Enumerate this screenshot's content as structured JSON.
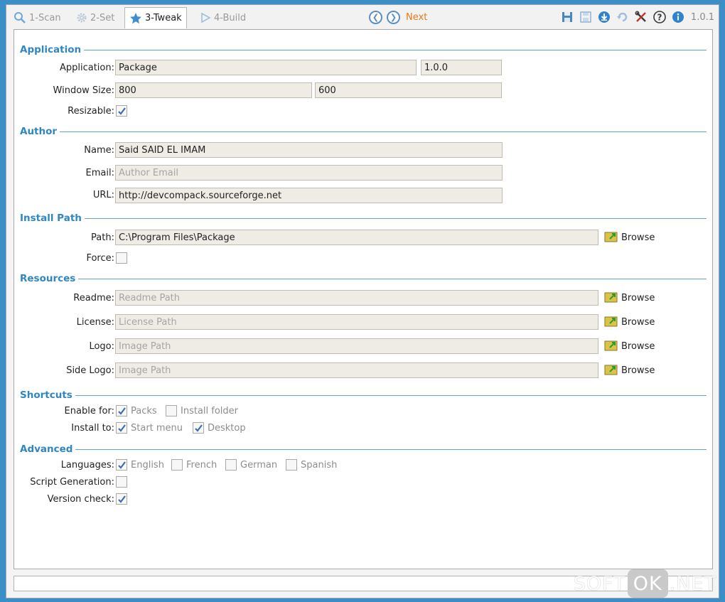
{
  "toolbar": {
    "tabs": [
      {
        "label": "1-Scan",
        "icon": "search-icon"
      },
      {
        "label": "2-Set",
        "icon": "gear-icon"
      },
      {
        "label": "3-Tweak",
        "icon": "star-icon"
      },
      {
        "label": "4-Build",
        "icon": "play-icon"
      }
    ],
    "next_label": "Next",
    "version": "1.0.1"
  },
  "sections": {
    "application": "Application",
    "author": "Author",
    "install_path": "Install Path",
    "resources": "Resources",
    "shortcuts": "Shortcuts",
    "advanced": "Advanced"
  },
  "application": {
    "name_label": "Application:",
    "name_value": "Package",
    "version_value": "1.0.0",
    "window_size_label": "Window Size:",
    "width_value": "800",
    "height_value": "600",
    "resizable_label": "Resizable:",
    "resizable_checked": true
  },
  "author": {
    "name_label": "Name:",
    "name_value": "Said SAID EL IMAM",
    "email_label": "Email:",
    "email_value": "",
    "email_placeholder": "Author Email",
    "url_label": "URL:",
    "url_value": "http://devcompack.sourceforge.net"
  },
  "install": {
    "path_label": "Path:",
    "path_value": "C:\\Program Files\\Package",
    "force_label": "Force:",
    "force_checked": false,
    "browse_label": "Browse"
  },
  "resources": {
    "readme_label": "Readme:",
    "readme_placeholder": "Readme Path",
    "license_label": "License:",
    "license_placeholder": "License Path",
    "logo_label": "Logo:",
    "logo_placeholder": "Image Path",
    "side_logo_label": "Side Logo:",
    "side_logo_placeholder": "Image Path",
    "browse_label": "Browse"
  },
  "shortcuts": {
    "enable_label": "Enable for:",
    "enable_options": [
      {
        "label": "Packs",
        "checked": true
      },
      {
        "label": "Install folder",
        "checked": false
      }
    ],
    "install_label": "Install to:",
    "install_options": [
      {
        "label": "Start menu",
        "checked": true
      },
      {
        "label": "Desktop",
        "checked": true
      }
    ]
  },
  "advanced": {
    "languages_label": "Languages:",
    "languages": [
      {
        "label": "English",
        "checked": true
      },
      {
        "label": "French",
        "checked": false
      },
      {
        "label": "German",
        "checked": false
      },
      {
        "label": "Spanish",
        "checked": false
      }
    ],
    "script_label": "Script Generation:",
    "script_checked": false,
    "version_label": "Version check:",
    "version_checked": true
  },
  "watermark": {
    "left": "SOFT",
    "middle": "OK",
    "right": ".NET"
  }
}
